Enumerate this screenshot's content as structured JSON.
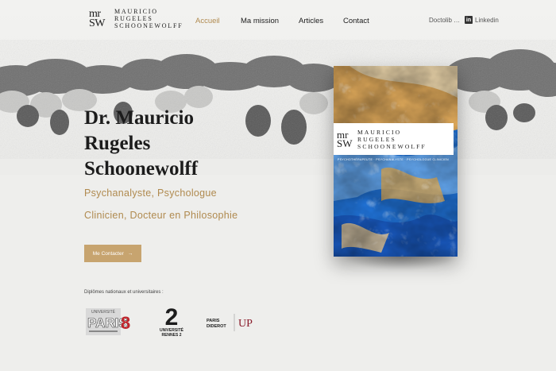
{
  "header": {
    "logo_mark_line1": "mr",
    "logo_mark_line2": "SW",
    "logo_word1": "MAURICIO",
    "logo_word2": "RUGELES",
    "logo_word3": "SCHOONEWOLFF",
    "nav": [
      {
        "label": "Accueil",
        "active": true
      },
      {
        "label": "Ma mission",
        "active": false
      },
      {
        "label": "Articles",
        "active": false
      },
      {
        "label": "Contact",
        "active": false
      }
    ],
    "doctolib_label": "Doctolib",
    "linkedin_label": "Linkedin"
  },
  "hero": {
    "name_line1": "Dr. Mauricio",
    "name_line2": "Rugeles",
    "name_line3": "Schoonewolff",
    "subtitle1": "Psychanalyste, Psychologue",
    "subtitle2": "Clinicien, Docteur en Philosophie",
    "cta_label": "Me Contacter",
    "cta_arrow": "→",
    "diplomas_label": "Diplômes nationaux et universitaires :"
  },
  "book": {
    "mark_line1": "mr",
    "mark_line2": "SW",
    "word1": "MAURICIO",
    "word2": "RUGELES",
    "word3": "SCHOONEWOLFF",
    "tagline": "PSYCHOTHÉRAPEUTE · PSYCHANALYSTE · PSYCHOLOGUE CLINICIEN"
  },
  "universities": {
    "paris8_top": "UNIVERSITÉ",
    "paris8_name": "PARIS",
    "paris8_num": "8",
    "rennes_num": "2",
    "rennes_line1": "UNIVERSITÉ",
    "rennes_line2": "RENNES 2",
    "diderot_line1": "PARIS",
    "diderot_line2": "DIDEROT",
    "up_mark": "UP"
  },
  "colors": {
    "accent": "#b08a4f",
    "button": "#c7a46f",
    "text": "#1c1c1c",
    "background": "#eeeeec"
  }
}
